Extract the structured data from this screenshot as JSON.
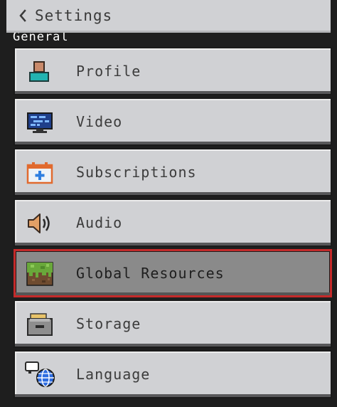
{
  "header": {
    "title": "Settings",
    "back_icon": "chevron-left-icon"
  },
  "section": {
    "label": "General"
  },
  "menu": {
    "selected": "Global Resources",
    "items": [
      {
        "label": "Profile",
        "icon": "profile-icon"
      },
      {
        "label": "Video",
        "icon": "monitor-icon"
      },
      {
        "label": "Subscriptions",
        "icon": "subscriptions-icon"
      },
      {
        "label": "Audio",
        "icon": "speaker-icon"
      },
      {
        "label": "Global Resources",
        "icon": "grass-block-icon"
      },
      {
        "label": "Storage",
        "icon": "storage-icon"
      },
      {
        "label": "Language",
        "icon": "language-icon"
      }
    ]
  },
  "colors": {
    "button_bg": "#d0d1d4",
    "selected_bg": "#8a8a8a",
    "selected_border": "#c42a2a",
    "text": "#3c3c3c",
    "background": "#1e1e1e"
  }
}
